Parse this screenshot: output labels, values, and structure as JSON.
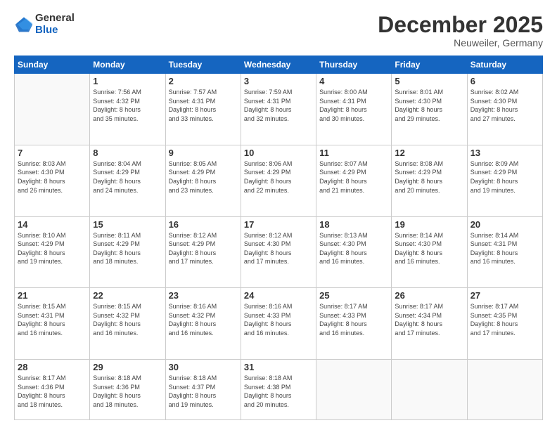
{
  "logo": {
    "general": "General",
    "blue": "Blue"
  },
  "header": {
    "month": "December 2025",
    "location": "Neuweiler, Germany"
  },
  "days_of_week": [
    "Sunday",
    "Monday",
    "Tuesday",
    "Wednesday",
    "Thursday",
    "Friday",
    "Saturday"
  ],
  "weeks": [
    [
      {
        "num": "",
        "detail": ""
      },
      {
        "num": "1",
        "detail": "Sunrise: 7:56 AM\nSunset: 4:32 PM\nDaylight: 8 hours\nand 35 minutes."
      },
      {
        "num": "2",
        "detail": "Sunrise: 7:57 AM\nSunset: 4:31 PM\nDaylight: 8 hours\nand 33 minutes."
      },
      {
        "num": "3",
        "detail": "Sunrise: 7:59 AM\nSunset: 4:31 PM\nDaylight: 8 hours\nand 32 minutes."
      },
      {
        "num": "4",
        "detail": "Sunrise: 8:00 AM\nSunset: 4:31 PM\nDaylight: 8 hours\nand 30 minutes."
      },
      {
        "num": "5",
        "detail": "Sunrise: 8:01 AM\nSunset: 4:30 PM\nDaylight: 8 hours\nand 29 minutes."
      },
      {
        "num": "6",
        "detail": "Sunrise: 8:02 AM\nSunset: 4:30 PM\nDaylight: 8 hours\nand 27 minutes."
      }
    ],
    [
      {
        "num": "7",
        "detail": "Sunrise: 8:03 AM\nSunset: 4:30 PM\nDaylight: 8 hours\nand 26 minutes."
      },
      {
        "num": "8",
        "detail": "Sunrise: 8:04 AM\nSunset: 4:29 PM\nDaylight: 8 hours\nand 24 minutes."
      },
      {
        "num": "9",
        "detail": "Sunrise: 8:05 AM\nSunset: 4:29 PM\nDaylight: 8 hours\nand 23 minutes."
      },
      {
        "num": "10",
        "detail": "Sunrise: 8:06 AM\nSunset: 4:29 PM\nDaylight: 8 hours\nand 22 minutes."
      },
      {
        "num": "11",
        "detail": "Sunrise: 8:07 AM\nSunset: 4:29 PM\nDaylight: 8 hours\nand 21 minutes."
      },
      {
        "num": "12",
        "detail": "Sunrise: 8:08 AM\nSunset: 4:29 PM\nDaylight: 8 hours\nand 20 minutes."
      },
      {
        "num": "13",
        "detail": "Sunrise: 8:09 AM\nSunset: 4:29 PM\nDaylight: 8 hours\nand 19 minutes."
      }
    ],
    [
      {
        "num": "14",
        "detail": "Sunrise: 8:10 AM\nSunset: 4:29 PM\nDaylight: 8 hours\nand 19 minutes."
      },
      {
        "num": "15",
        "detail": "Sunrise: 8:11 AM\nSunset: 4:29 PM\nDaylight: 8 hours\nand 18 minutes."
      },
      {
        "num": "16",
        "detail": "Sunrise: 8:12 AM\nSunset: 4:29 PM\nDaylight: 8 hours\nand 17 minutes."
      },
      {
        "num": "17",
        "detail": "Sunrise: 8:12 AM\nSunset: 4:30 PM\nDaylight: 8 hours\nand 17 minutes."
      },
      {
        "num": "18",
        "detail": "Sunrise: 8:13 AM\nSunset: 4:30 PM\nDaylight: 8 hours\nand 16 minutes."
      },
      {
        "num": "19",
        "detail": "Sunrise: 8:14 AM\nSunset: 4:30 PM\nDaylight: 8 hours\nand 16 minutes."
      },
      {
        "num": "20",
        "detail": "Sunrise: 8:14 AM\nSunset: 4:31 PM\nDaylight: 8 hours\nand 16 minutes."
      }
    ],
    [
      {
        "num": "21",
        "detail": "Sunrise: 8:15 AM\nSunset: 4:31 PM\nDaylight: 8 hours\nand 16 minutes."
      },
      {
        "num": "22",
        "detail": "Sunrise: 8:15 AM\nSunset: 4:32 PM\nDaylight: 8 hours\nand 16 minutes."
      },
      {
        "num": "23",
        "detail": "Sunrise: 8:16 AM\nSunset: 4:32 PM\nDaylight: 8 hours\nand 16 minutes."
      },
      {
        "num": "24",
        "detail": "Sunrise: 8:16 AM\nSunset: 4:33 PM\nDaylight: 8 hours\nand 16 minutes."
      },
      {
        "num": "25",
        "detail": "Sunrise: 8:17 AM\nSunset: 4:33 PM\nDaylight: 8 hours\nand 16 minutes."
      },
      {
        "num": "26",
        "detail": "Sunrise: 8:17 AM\nSunset: 4:34 PM\nDaylight: 8 hours\nand 17 minutes."
      },
      {
        "num": "27",
        "detail": "Sunrise: 8:17 AM\nSunset: 4:35 PM\nDaylight: 8 hours\nand 17 minutes."
      }
    ],
    [
      {
        "num": "28",
        "detail": "Sunrise: 8:17 AM\nSunset: 4:36 PM\nDaylight: 8 hours\nand 18 minutes."
      },
      {
        "num": "29",
        "detail": "Sunrise: 8:18 AM\nSunset: 4:36 PM\nDaylight: 8 hours\nand 18 minutes."
      },
      {
        "num": "30",
        "detail": "Sunrise: 8:18 AM\nSunset: 4:37 PM\nDaylight: 8 hours\nand 19 minutes."
      },
      {
        "num": "31",
        "detail": "Sunrise: 8:18 AM\nSunset: 4:38 PM\nDaylight: 8 hours\nand 20 minutes."
      },
      {
        "num": "",
        "detail": ""
      },
      {
        "num": "",
        "detail": ""
      },
      {
        "num": "",
        "detail": ""
      }
    ]
  ]
}
